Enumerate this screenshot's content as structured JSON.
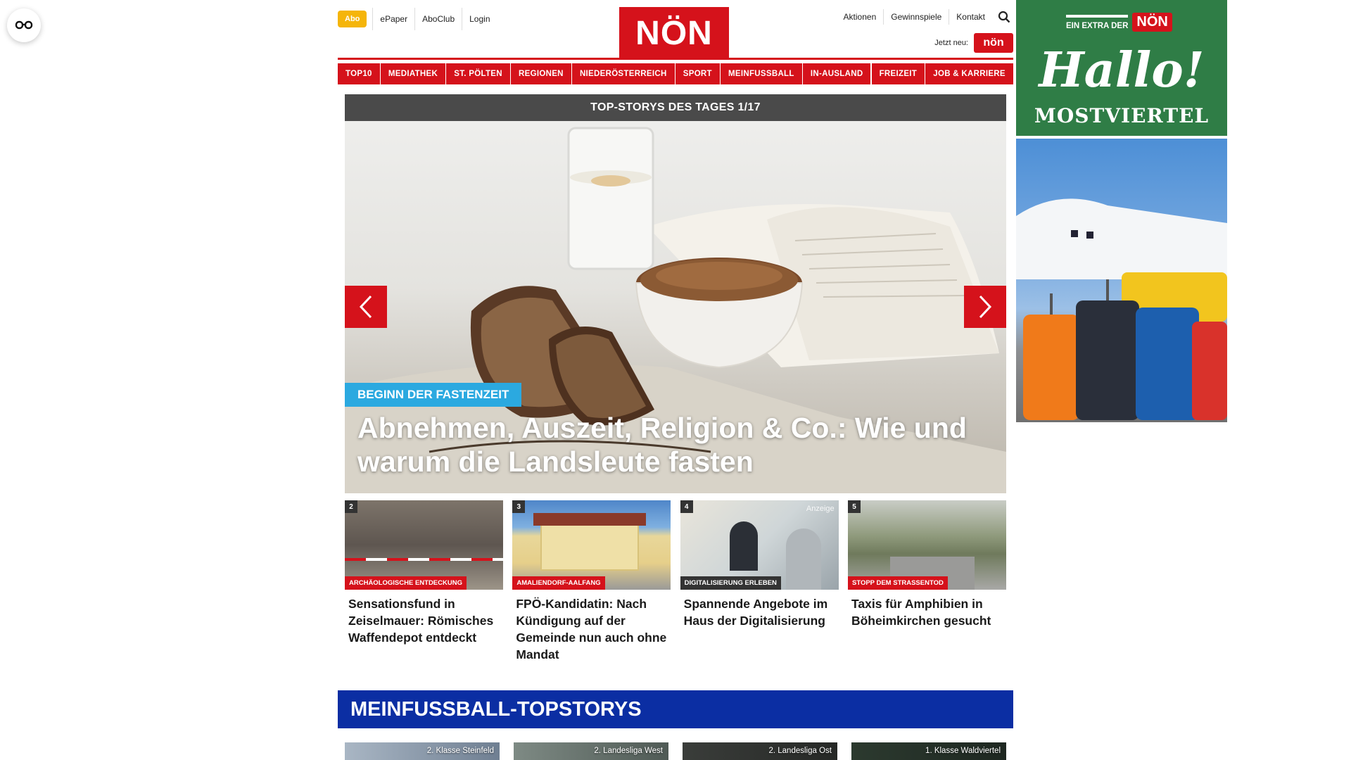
{
  "topbar": {
    "abo": "Abo",
    "links": [
      "ePaper",
      "AboClub",
      "Login"
    ]
  },
  "brand": {
    "logo": "NÖN",
    "accent": "#d5121b"
  },
  "right_links": [
    "Aktionen",
    "Gewinnspiele",
    "Kontakt"
  ],
  "jetzt": {
    "label": "Jetzt neu:",
    "logo": "nön"
  },
  "nav": [
    "TOP10",
    "MEDIATHEK",
    "ST. PÖLTEN",
    "REGIONEN",
    "NIEDERÖSTERREICH",
    "SPORT",
    "MEINFUSSBALL",
    "IN-AUSLAND",
    "FREIZEIT",
    "JOB & KARRIERE"
  ],
  "hero": {
    "header": "TOP-STORYS DES TAGES 1/17",
    "kicker": "BEGINN DER FASTENZEIT",
    "headline": "Abnehmen, Auszeit, Religion & Co.: Wie und warum die Landsleute fasten"
  },
  "teasers": [
    {
      "num": "2",
      "tag": "ARCHÄOLOGISCHE ENTDECKUNG",
      "title": "Sensationsfund in Zeiselmauer: Römisches Waffendepot entdeckt"
    },
    {
      "num": "3",
      "tag": "AMALIENDORF-AALFANG",
      "title": "FPÖ-Kandidatin: Nach Kündigung auf der Gemeinde nun auch ohne Mandat"
    },
    {
      "num": "4",
      "tag": "DIGITALISIERUNG ERLEBEN",
      "anzeige": "Anzeige",
      "title": "Spannende Angebote im Haus der Digitalisierung"
    },
    {
      "num": "5",
      "tag": "STOPP DEM STRASSENTOD",
      "title": "Taxis für Amphibien in Böheimkirchen gesucht"
    }
  ],
  "meinfussball": {
    "title": "MEINFUSSBALL-TOPSTORYS",
    "cards": [
      "2. Klasse Steinfeld",
      "2. Landesliga West",
      "2. Landesliga Ost",
      "1. Klasse Waldviertel"
    ]
  },
  "ads": {
    "ad1": {
      "top": "EIN EXTRA DER",
      "logo": "NÖN",
      "hallo": "Hallo!",
      "region": "MOSTVIERTEL"
    }
  }
}
